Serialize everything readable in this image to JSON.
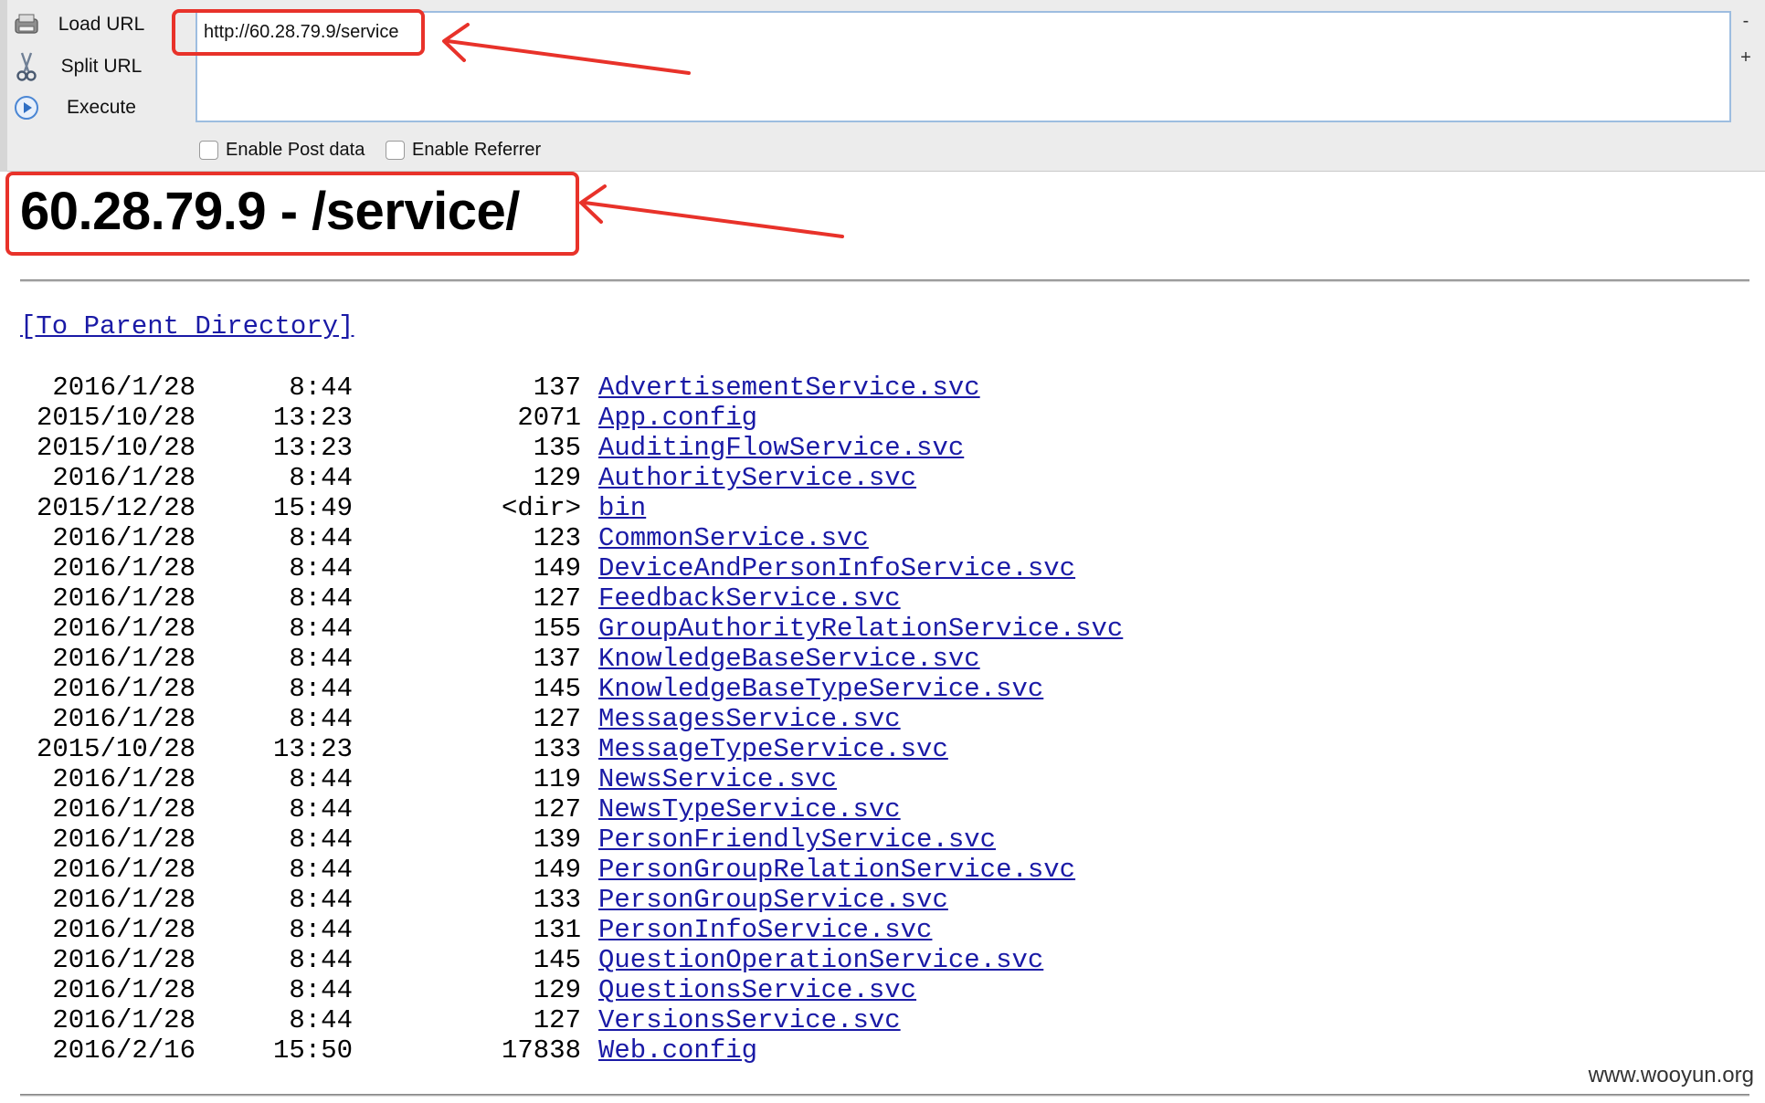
{
  "toolbar": {
    "load_label": "Load URL",
    "split_label": "Split URL",
    "execute_label": "Execute",
    "url_value": "http://60.28.79.9/service",
    "minus_label": "-",
    "plus_label": "+",
    "enable_post_label": "Enable Post data",
    "enable_referrer_label": "Enable Referrer"
  },
  "page": {
    "title": "60.28.79.9 - /service/",
    "parent_link": "[To Parent Directory]",
    "entries": [
      {
        "date": "2016/1/28",
        "time": "8:44",
        "size": "137",
        "name": "AdvertisementService.svc"
      },
      {
        "date": "2015/10/28",
        "time": "13:23",
        "size": "2071",
        "name": "App.config"
      },
      {
        "date": "2015/10/28",
        "time": "13:23",
        "size": "135",
        "name": "AuditingFlowService.svc"
      },
      {
        "date": "2016/1/28",
        "time": "8:44",
        "size": "129",
        "name": "AuthorityService.svc"
      },
      {
        "date": "2015/12/28",
        "time": "15:49",
        "size": "<dir>",
        "name": "bin"
      },
      {
        "date": "2016/1/28",
        "time": "8:44",
        "size": "123",
        "name": "CommonService.svc"
      },
      {
        "date": "2016/1/28",
        "time": "8:44",
        "size": "149",
        "name": "DeviceAndPersonInfoService.svc"
      },
      {
        "date": "2016/1/28",
        "time": "8:44",
        "size": "127",
        "name": "FeedbackService.svc"
      },
      {
        "date": "2016/1/28",
        "time": "8:44",
        "size": "155",
        "name": "GroupAuthorityRelationService.svc"
      },
      {
        "date": "2016/1/28",
        "time": "8:44",
        "size": "137",
        "name": "KnowledgeBaseService.svc"
      },
      {
        "date": "2016/1/28",
        "time": "8:44",
        "size": "145",
        "name": "KnowledgeBaseTypeService.svc"
      },
      {
        "date": "2016/1/28",
        "time": "8:44",
        "size": "127",
        "name": "MessagesService.svc"
      },
      {
        "date": "2015/10/28",
        "time": "13:23",
        "size": "133",
        "name": "MessageTypeService.svc"
      },
      {
        "date": "2016/1/28",
        "time": "8:44",
        "size": "119",
        "name": "NewsService.svc"
      },
      {
        "date": "2016/1/28",
        "time": "8:44",
        "size": "127",
        "name": "NewsTypeService.svc"
      },
      {
        "date": "2016/1/28",
        "time": "8:44",
        "size": "139",
        "name": "PersonFriendlyService.svc"
      },
      {
        "date": "2016/1/28",
        "time": "8:44",
        "size": "149",
        "name": "PersonGroupRelationService.svc"
      },
      {
        "date": "2016/1/28",
        "time": "8:44",
        "size": "133",
        "name": "PersonGroupService.svc"
      },
      {
        "date": "2016/1/28",
        "time": "8:44",
        "size": "131",
        "name": "PersonInfoService.svc"
      },
      {
        "date": "2016/1/28",
        "time": "8:44",
        "size": "145",
        "name": "QuestionOperationService.svc"
      },
      {
        "date": "2016/1/28",
        "time": "8:44",
        "size": "129",
        "name": "QuestionsService.svc"
      },
      {
        "date": "2016/1/28",
        "time": "8:44",
        "size": "127",
        "name": "VersionsService.svc"
      },
      {
        "date": "2016/2/16",
        "time": "15:50",
        "size": "17838",
        "name": "Web.config"
      }
    ]
  },
  "watermark": "www.wooyun.org",
  "colors": {
    "annotation": "#e8322a",
    "link": "#1a1aa6",
    "toolbar_bg": "#ececec"
  },
  "icons": {
    "load": "load-url-icon",
    "split": "scissors-icon",
    "execute": "play-icon"
  }
}
